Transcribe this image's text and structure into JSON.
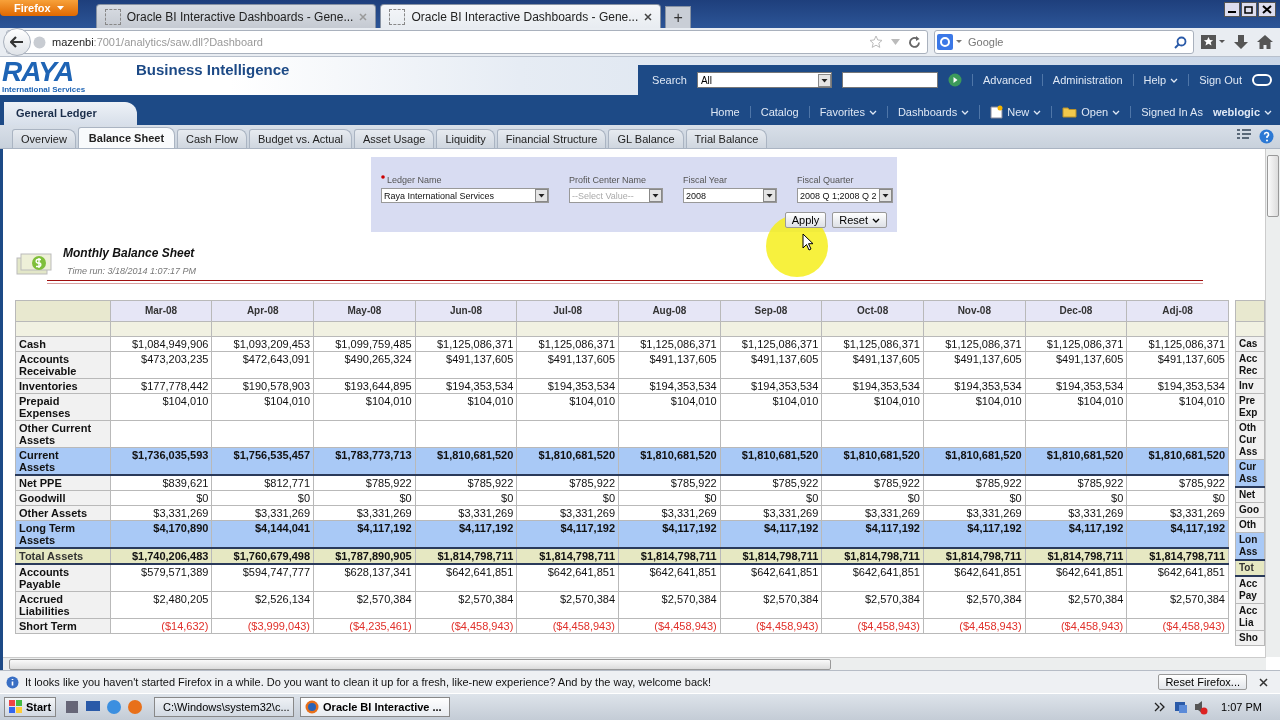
{
  "browser": {
    "menu_button": "Firefox",
    "tabs": [
      {
        "title": "Oracle BI Interactive Dashboards - Gene...",
        "selected": false
      },
      {
        "title": "Oracle BI Interactive Dashboards - Gene...",
        "selected": true
      }
    ],
    "new_tab": "+",
    "address": {
      "host": "mazenbi",
      "path": ":7001/analytics/saw.dll?Dashboard"
    },
    "search": {
      "placeholder": "Google"
    }
  },
  "header": {
    "logo": {
      "name": "RAYA",
      "tagline": "International Services"
    },
    "product": "Business Intelligence",
    "search_label": "Search",
    "search_scope": "All",
    "links": [
      {
        "label": "Advanced",
        "menu": false
      },
      {
        "label": "Administration",
        "menu": false
      },
      {
        "label": "Help",
        "menu": true
      },
      {
        "label": "Sign Out",
        "menu": false
      }
    ]
  },
  "nav": {
    "section": "General Ledger",
    "links": [
      {
        "label": "Home",
        "menu": false,
        "kind": "plain"
      },
      {
        "label": "Catalog",
        "menu": false,
        "kind": "plain"
      },
      {
        "label": "Favorites",
        "menu": true,
        "kind": "plain"
      },
      {
        "label": "Dashboards",
        "menu": true,
        "kind": "plain"
      },
      {
        "label": "New",
        "menu": true,
        "kind": "new"
      },
      {
        "label": "Open",
        "menu": true,
        "kind": "folder"
      }
    ],
    "signed_in_label": "Signed In As",
    "user": "weblogic"
  },
  "page_tabs": [
    {
      "label": "Overview",
      "selected": false
    },
    {
      "label": "Balance Sheet",
      "selected": true
    },
    {
      "label": "Cash Flow",
      "selected": false
    },
    {
      "label": "Budget vs. Actual",
      "selected": false
    },
    {
      "label": "Asset Usage",
      "selected": false
    },
    {
      "label": "Liquidity",
      "selected": false
    },
    {
      "label": "Financial Structure",
      "selected": false
    },
    {
      "label": "GL Balance",
      "selected": false
    },
    {
      "label": "Trial Balance",
      "selected": false
    }
  ],
  "prompts": {
    "fields": [
      {
        "label": "Ledger Name",
        "required": true,
        "value": "Raya International Services"
      },
      {
        "label": "Profit Center Name",
        "required": false,
        "placeholder": "--Select Value--"
      },
      {
        "label": "Fiscal Year",
        "required": false,
        "value": "2008"
      },
      {
        "label": "Fiscal Quarter",
        "required": false,
        "value": "2008 Q 1;2008 Q 2"
      }
    ],
    "apply": "Apply",
    "reset": "Reset"
  },
  "report": {
    "title": "Monthly Balance Sheet",
    "time_run": "Time run: 3/18/2014 1:07:17 PM"
  },
  "table": {
    "columns": [
      "Mar-08",
      "Apr-08",
      "May-08",
      "Jun-08",
      "Jul-08",
      "Aug-08",
      "Sep-08",
      "Oct-08",
      "Nov-08",
      "Dec-08",
      "Adj-08"
    ],
    "rows": [
      {
        "label": "Cash",
        "kind": "detail",
        "repeat_label": "Cas",
        "values": [
          "$1,084,949,906",
          "$1,093,209,453",
          "$1,099,759,485",
          "$1,125,086,371",
          "$1,125,086,371",
          "$1,125,086,371",
          "$1,125,086,371",
          "$1,125,086,371",
          "$1,125,086,371",
          "$1,125,086,371",
          "$1,125,086,371"
        ]
      },
      {
        "label": "Accounts Receivable",
        "kind": "detail",
        "repeat_label": "Acc Rec",
        "values": [
          "$473,203,235",
          "$472,643,091",
          "$490,265,324",
          "$491,137,605",
          "$491,137,605",
          "$491,137,605",
          "$491,137,605",
          "$491,137,605",
          "$491,137,605",
          "$491,137,605",
          "$491,137,605"
        ]
      },
      {
        "label": "Inventories",
        "kind": "detail",
        "repeat_label": "Inv",
        "values": [
          "$177,778,442",
          "$190,578,903",
          "$193,644,895",
          "$194,353,534",
          "$194,353,534",
          "$194,353,534",
          "$194,353,534",
          "$194,353,534",
          "$194,353,534",
          "$194,353,534",
          "$194,353,534"
        ]
      },
      {
        "label": "Prepaid Expenses",
        "kind": "detail",
        "repeat_label": "Pre Exp",
        "values": [
          "$104,010",
          "$104,010",
          "$104,010",
          "$104,010",
          "$104,010",
          "$104,010",
          "$104,010",
          "$104,010",
          "$104,010",
          "$104,010",
          "$104,010"
        ]
      },
      {
        "label": "Other Current Assets",
        "kind": "detail",
        "repeat_label": "Oth Cur Ass",
        "values": []
      },
      {
        "label": "Current Assets",
        "kind": "subtotal",
        "repeat_label": "Cur Ass",
        "values": [
          "$1,736,035,593",
          "$1,756,535,457",
          "$1,783,773,713",
          "$1,810,681,520",
          "$1,810,681,520",
          "$1,810,681,520",
          "$1,810,681,520",
          "$1,810,681,520",
          "$1,810,681,520",
          "$1,810,681,520",
          "$1,810,681,520"
        ]
      },
      {
        "label": "Net PPE",
        "kind": "detail",
        "repeat_label": "Net",
        "values": [
          "$839,621",
          "$812,771",
          "$785,922",
          "$785,922",
          "$785,922",
          "$785,922",
          "$785,922",
          "$785,922",
          "$785,922",
          "$785,922",
          "$785,922"
        ]
      },
      {
        "label": "Goodwill",
        "kind": "detail",
        "repeat_label": "Goo",
        "values": [
          "$0",
          "$0",
          "$0",
          "$0",
          "$0",
          "$0",
          "$0",
          "$0",
          "$0",
          "$0",
          "$0"
        ]
      },
      {
        "label": "Other Assets",
        "kind": "detail",
        "repeat_label": "Oth",
        "values": [
          "$3,331,269",
          "$3,331,269",
          "$3,331,269",
          "$3,331,269",
          "$3,331,269",
          "$3,331,269",
          "$3,331,269",
          "$3,331,269",
          "$3,331,269",
          "$3,331,269",
          "$3,331,269"
        ]
      },
      {
        "label": "Long Term Assets",
        "kind": "subtotal",
        "repeat_label": "Lon Ass",
        "values": [
          "$4,170,890",
          "$4,144,041",
          "$4,117,192",
          "$4,117,192",
          "$4,117,192",
          "$4,117,192",
          "$4,117,192",
          "$4,117,192",
          "$4,117,192",
          "$4,117,192",
          "$4,117,192"
        ]
      },
      {
        "label": "Total Assets",
        "kind": "total",
        "repeat_label": "Tot",
        "values": [
          "$1,740,206,483",
          "$1,760,679,498",
          "$1,787,890,905",
          "$1,814,798,711",
          "$1,814,798,711",
          "$1,814,798,711",
          "$1,814,798,711",
          "$1,814,798,711",
          "$1,814,798,711",
          "$1,814,798,711",
          "$1,814,798,711"
        ]
      },
      {
        "label": "Accounts Payable",
        "kind": "detail",
        "repeat_label": "Acc Pay",
        "values": [
          "$579,571,389",
          "$594,747,777",
          "$628,137,341",
          "$642,641,851",
          "$642,641,851",
          "$642,641,851",
          "$642,641,851",
          "$642,641,851",
          "$642,641,851",
          "$642,641,851",
          "$642,641,851"
        ]
      },
      {
        "label": "Accrued Liabilities",
        "kind": "detail",
        "repeat_label": "Acc Lia",
        "values": [
          "$2,480,205",
          "$2,526,134",
          "$2,570,384",
          "$2,570,384",
          "$2,570,384",
          "$2,570,384",
          "$2,570,384",
          "$2,570,384",
          "$2,570,384",
          "$2,570,384",
          "$2,570,384"
        ]
      },
      {
        "label": "Short Term",
        "kind": "negative",
        "repeat_label": "Sho",
        "values": [
          "($14,632)",
          "($3,999,043)",
          "($4,235,461)",
          "($4,458,943)",
          "($4,458,943)",
          "($4,458,943)",
          "($4,458,943)",
          "($4,458,943)",
          "($4,458,943)",
          "($4,458,943)",
          "($4,458,943)"
        ]
      }
    ]
  },
  "notification": {
    "message": "It looks like you haven't started Firefox in a while. Do you want to clean it up for a fresh, like-new experience? And by the way, welcome back!",
    "button": "Reset Firefox..."
  },
  "taskbar": {
    "start": "Start",
    "tasks": [
      {
        "title": "C:\\Windows\\system32\\c...",
        "selected": false,
        "kind": "console"
      },
      {
        "title": "Oracle BI Interactive ...",
        "selected": true,
        "kind": "browser"
      }
    ],
    "clock": "1:07 PM"
  }
}
